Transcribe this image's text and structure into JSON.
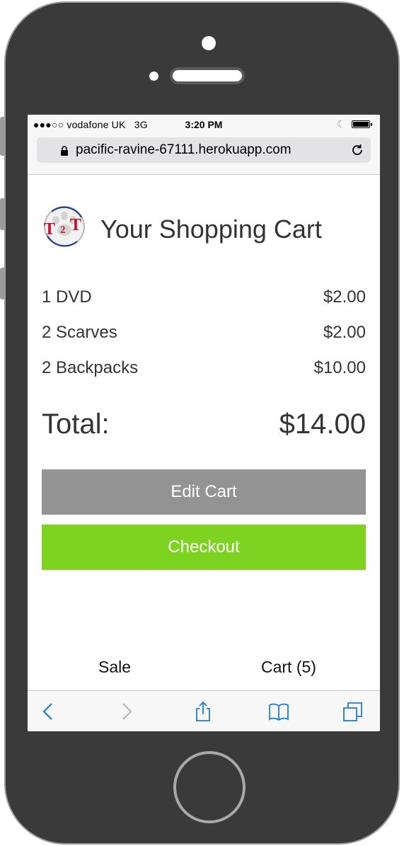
{
  "status_bar": {
    "carrier": "●●●○○ vodafone UK",
    "network": "3G",
    "time": "3:20 PM"
  },
  "address_bar": {
    "url": "pacific-ravine-67111.herokuapp.com"
  },
  "page": {
    "logo_text": "T2T",
    "title": "Your Shopping Cart"
  },
  "cart": {
    "items": [
      {
        "name": "1 DVD",
        "price": "$2.00"
      },
      {
        "name": "2 Scarves",
        "price": "$2.00"
      },
      {
        "name": "2 Backpacks",
        "price": "$10.00"
      }
    ],
    "total_label": "Total:",
    "total_value": "$14.00"
  },
  "buttons": {
    "edit_cart": "Edit Cart",
    "checkout": "Checkout"
  },
  "nav": {
    "sale": "Sale",
    "cart": "Cart (5)"
  },
  "toolbar": {
    "icons": [
      "back-icon",
      "forward-icon",
      "share-icon",
      "bookmarks-icon",
      "tabs-icon"
    ]
  },
  "colors": {
    "accent_link": "#1a7dd7",
    "checkout_green": "#7ed321",
    "edit_gray": "#939393",
    "logo_red": "#c8102e"
  }
}
